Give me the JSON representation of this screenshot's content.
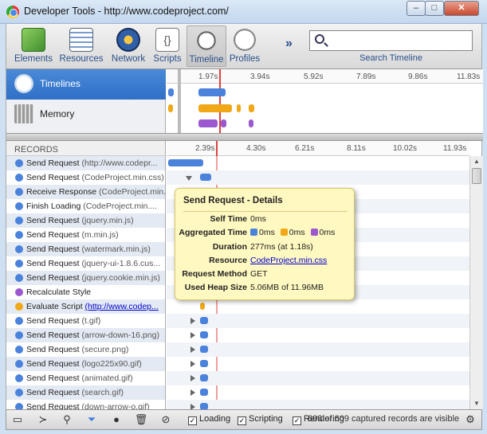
{
  "window": {
    "title": "Developer Tools - http://www.codeproject.com/",
    "minimize": "–",
    "maximize": "□",
    "close": "✕"
  },
  "toolbar": {
    "items": [
      {
        "label": "Elements",
        "icon": "elements-icon"
      },
      {
        "label": "Resources",
        "icon": "resources-icon"
      },
      {
        "label": "Network",
        "icon": "network-icon"
      },
      {
        "label": "Scripts",
        "icon": "scripts-icon"
      },
      {
        "label": "Timeline",
        "icon": "timeline-icon",
        "active": true
      },
      {
        "label": "Profiles",
        "icon": "profiles-icon"
      }
    ],
    "more": "»",
    "search_label": "Search Timeline"
  },
  "overview": {
    "timelines_label": "Timelines",
    "memory_label": "Memory",
    "ticks": [
      "1.97s",
      "3.94s",
      "5.92s",
      "7.89s",
      "9.86s",
      "11.83s"
    ]
  },
  "records": {
    "header": "RECORDS",
    "ticks": [
      "2.39s",
      "4.30s",
      "6.21s",
      "8.11s",
      "10.02s",
      "11.93s"
    ],
    "rows": [
      {
        "type": "Send Request",
        "detail": "(http://www.codepr...",
        "color": "#4a82dc"
      },
      {
        "type": "Send Request",
        "detail": "(CodeProject.min.css)",
        "color": "#4a82dc"
      },
      {
        "type": "Receive Response",
        "detail": "(CodeProject.min....",
        "color": "#4a82dc"
      },
      {
        "type": "Finish Loading",
        "detail": "(CodeProject.min....",
        "color": "#4a82dc"
      },
      {
        "type": "Send Request",
        "detail": "(jquery.min.js)",
        "color": "#4a82dc"
      },
      {
        "type": "Send Request",
        "detail": "(m.min.js)",
        "color": "#4a82dc"
      },
      {
        "type": "Send Request",
        "detail": "(watermark.min.js)",
        "color": "#4a82dc"
      },
      {
        "type": "Send Request",
        "detail": "(jquery-ui-1.8.6.cus...",
        "color": "#4a82dc"
      },
      {
        "type": "Send Request",
        "detail": "(jquery.cookie.min.js)",
        "color": "#4a82dc"
      },
      {
        "type": "Recalculate Style",
        "detail": "",
        "color": "#9b59d0"
      },
      {
        "type": "Evaluate Script",
        "detail": "(http://www.codep...",
        "color": "#f0a818",
        "link": true
      },
      {
        "type": "Send Request",
        "detail": "(t.gif)",
        "color": "#4a82dc"
      },
      {
        "type": "Send Request",
        "detail": "(arrow-down-16.png)",
        "color": "#4a82dc"
      },
      {
        "type": "Send Request",
        "detail": "(secure.png)",
        "color": "#4a82dc"
      },
      {
        "type": "Send Request",
        "detail": "(logo225x90.gif)",
        "color": "#4a82dc"
      },
      {
        "type": "Send Request",
        "detail": "(animated.gif)",
        "color": "#4a82dc"
      },
      {
        "type": "Send Request",
        "detail": "(search.gif)",
        "color": "#4a82dc"
      },
      {
        "type": "Send Request",
        "detail": "(down-arrow-o.gif)",
        "color": "#4a82dc"
      }
    ]
  },
  "popover": {
    "title": "Send Request - Details",
    "self_time_label": "Self Time",
    "self_time": "0ms",
    "aggregated_label": "Aggregated Time",
    "agg_loading": "0ms",
    "agg_scripting": "0ms",
    "agg_rendering": "0ms",
    "duration_label": "Duration",
    "duration": "277ms (at 1.18s)",
    "resource_label": "Resource",
    "resource": "CodeProject.min.css",
    "method_label": "Request Method",
    "method": "GET",
    "heap_label": "Used Heap Size",
    "heap": "5.06MB of 11.96MB"
  },
  "statusbar": {
    "loading": "Loading",
    "scripting": "Scripting",
    "rendering": "Rendering",
    "status": "608 of 609 captured records are visible"
  },
  "colors": {
    "loading": "#4a82dc",
    "scripting": "#f0a818",
    "rendering": "#9b59d0"
  }
}
